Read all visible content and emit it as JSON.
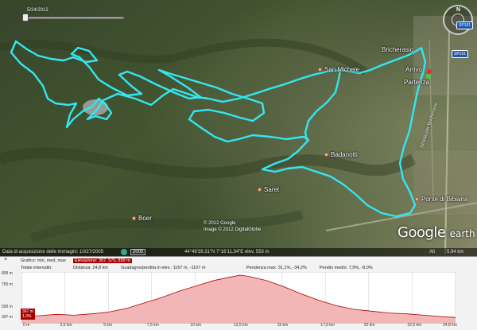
{
  "map": {
    "time_slider": {
      "date": "5/24/2012"
    },
    "places": [
      {
        "name": "Bricherasio"
      },
      {
        "name": "Arrivo"
      },
      {
        "name": "Partenza"
      },
      {
        "name": "San Michele"
      },
      {
        "name": "Badanotti"
      },
      {
        "name": "Saret"
      },
      {
        "name": "Ponte di Bibiana"
      },
      {
        "name": "Boer"
      }
    ],
    "road_shields": [
      "SP161",
      "SP161"
    ],
    "road_label": "Strada per Bricherasio",
    "copyright_line1": "© 2012 Google",
    "copyright_line2": "Image © 2012 DigitalGlobe",
    "logo_google": "Google",
    "logo_earth": "earth",
    "colors": {
      "track": "#33e6f0",
      "start_marker": "#3ad53a",
      "end_marker": "#e03030"
    }
  },
  "statusbar": {
    "imagery_date": "Data di acquisizione delle immagini: 10/27/2005",
    "year": "2005",
    "coords": "44°49'39.31\"N   7°16'11.34\"E   elev.  553 m",
    "alt": "Alt",
    "eye_alt": "5.94 km"
  },
  "elevation_profile": {
    "close_label": "×",
    "row1": {
      "label": "Grafico:  min,  med,  max",
      "value": "Elevazione: 397, 570, 899 m"
    },
    "row2": {
      "interval": "Totale intervallo:",
      "distance": "Distanza: 24,8 km",
      "gain_loss": "Guadagno/perdita in elev.: 1167 m, -1167 m",
      "slope_max": "Pendenza max: 31,1%, -34,2%",
      "slope_avg": "Pendio medio: 7,9%, -8,0%"
    },
    "y_ticks": [
      "899 m",
      "750 m",
      "500 m",
      "397 m"
    ],
    "x_ticks": [
      "0 m",
      "2,5 km",
      "5 km",
      "7,5 km",
      "10 km",
      "12,5 km",
      "15 km",
      "17,5 km",
      "20 km",
      "22,5 km",
      "24,8 km"
    ],
    "cursor_label_1": "397 m",
    "cursor_label_2": "1,3%",
    "fill_color": "#f2b6b6",
    "line_color": "#b00000"
  },
  "chart_data": {
    "type": "area",
    "x_unit": "km",
    "y_unit": "m",
    "ylim": [
      397,
      899
    ],
    "xlim": [
      0,
      24.8
    ],
    "x": [
      0,
      1,
      2,
      3,
      4,
      5,
      6,
      7,
      8,
      9,
      10,
      11,
      12,
      12.5,
      13,
      14,
      15,
      16,
      17,
      18,
      19,
      20,
      21,
      22,
      23,
      24,
      24.8
    ],
    "y": [
      440,
      450,
      465,
      455,
      470,
      490,
      530,
      590,
      650,
      720,
      780,
      840,
      880,
      899,
      885,
      840,
      770,
      690,
      620,
      560,
      520,
      500,
      480,
      470,
      455,
      440,
      430
    ]
  }
}
